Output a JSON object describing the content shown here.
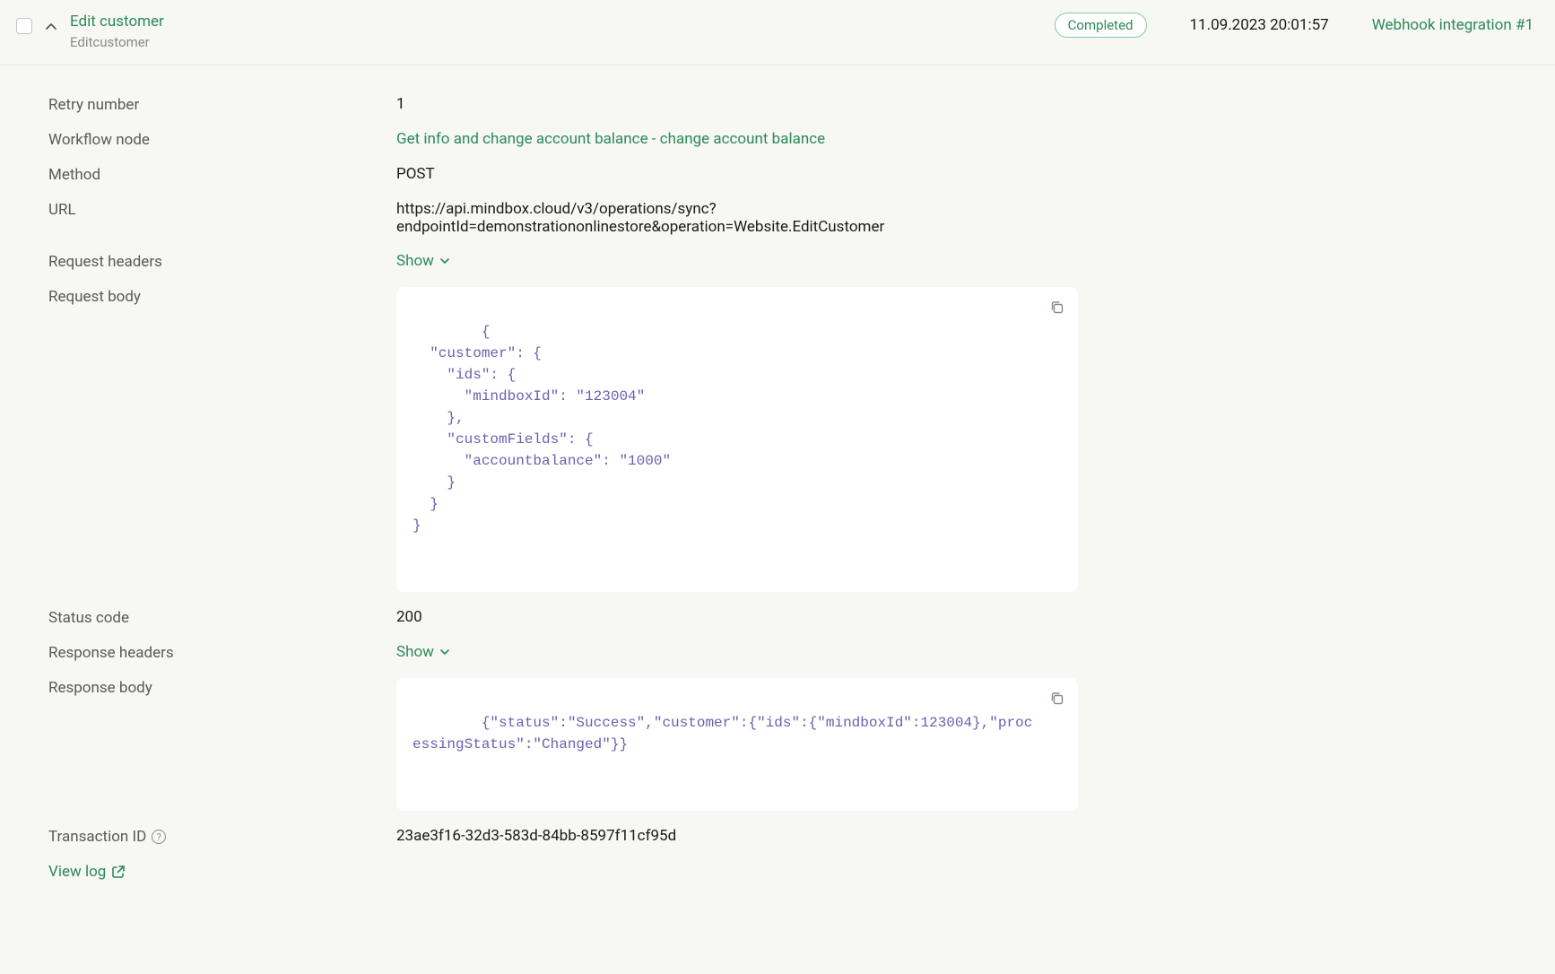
{
  "header": {
    "title": "Edit customer",
    "subtitle": "Editcustomer",
    "status": "Completed",
    "timestamp": "11.09.2023 20:01:57",
    "integration": "Webhook integration #1"
  },
  "labels": {
    "retry_number": "Retry number",
    "workflow_node": "Workflow node",
    "method": "Method",
    "url": "URL",
    "request_headers": "Request headers",
    "request_body": "Request body",
    "status_code": "Status code",
    "response_headers": "Response headers",
    "response_body": "Response body",
    "transaction_id": "Transaction ID",
    "show": "Show",
    "view_log": "View log"
  },
  "values": {
    "retry_number": "1",
    "workflow_node": "Get info and change account balance - change account balance",
    "method": "POST",
    "url": "https://api.mindbox.cloud/v3/operations/sync?endpointId=demonstrationonlinestore&operation=Website.EditCustomer",
    "request_body": "{\n  \"customer\": {\n    \"ids\": {\n      \"mindboxId\": \"123004\"\n    },\n    \"customFields\": {\n      \"accountbalance\": \"1000\"\n    }\n  }\n}",
    "status_code": "200",
    "response_body": "{\"status\":\"Success\",\"customer\":{\"ids\":{\"mindboxId\":123004},\"processingStatus\":\"Changed\"}}",
    "transaction_id": "23ae3f16-32d3-583d-84bb-8597f11cf95d"
  }
}
